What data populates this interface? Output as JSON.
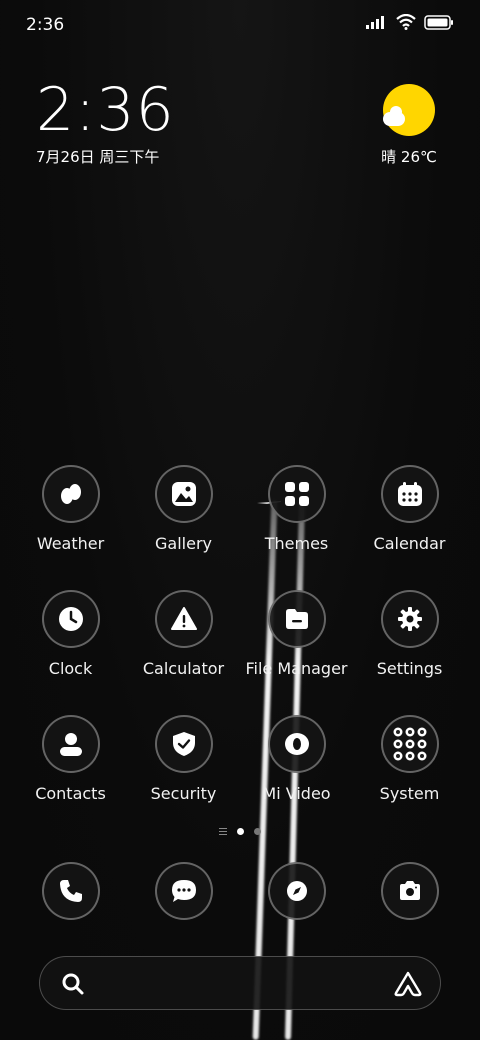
{
  "status_bar": {
    "time": "2:36",
    "icons": [
      "signal-icon",
      "wifi-icon",
      "battery-icon"
    ]
  },
  "clock_widget": {
    "time": "2:36",
    "date": "7月26日 周三下午"
  },
  "weather_widget": {
    "condition_temp": "晴 26℃",
    "icon": "sunny-cloud-icon",
    "sun_color": "#ffd600"
  },
  "apps": [
    {
      "label": "Weather",
      "icon": "weather-drops-icon"
    },
    {
      "label": "Gallery",
      "icon": "gallery-icon"
    },
    {
      "label": "Themes",
      "icon": "themes-icon"
    },
    {
      "label": "Calendar",
      "icon": "calendar-icon"
    },
    {
      "label": "Clock",
      "icon": "clock-icon"
    },
    {
      "label": "Calculator",
      "icon": "calculator-warning-icon"
    },
    {
      "label": "File Manager",
      "icon": "folder-icon"
    },
    {
      "label": "Settings",
      "icon": "gear-icon"
    },
    {
      "label": "Contacts",
      "icon": "contact-icon"
    },
    {
      "label": "Security",
      "icon": "shield-check-icon"
    },
    {
      "label": "Mi Video",
      "icon": "video-icon"
    },
    {
      "label": "System",
      "icon": "system-folder-icon"
    }
  ],
  "page_indicator": {
    "pages": 2,
    "active": 1
  },
  "dock": [
    {
      "name": "phone",
      "icon": "phone-icon"
    },
    {
      "name": "messages",
      "icon": "chat-bubble-icon"
    },
    {
      "name": "browser",
      "icon": "compass-icon"
    },
    {
      "name": "camera",
      "icon": "camera-icon"
    }
  ],
  "search_bar": {
    "left_icon": "search-icon",
    "right_icon": "assistant-icon"
  },
  "colors": {
    "background": "#0d0d0d",
    "ring": "rgba(255,255,255,0.35)"
  }
}
